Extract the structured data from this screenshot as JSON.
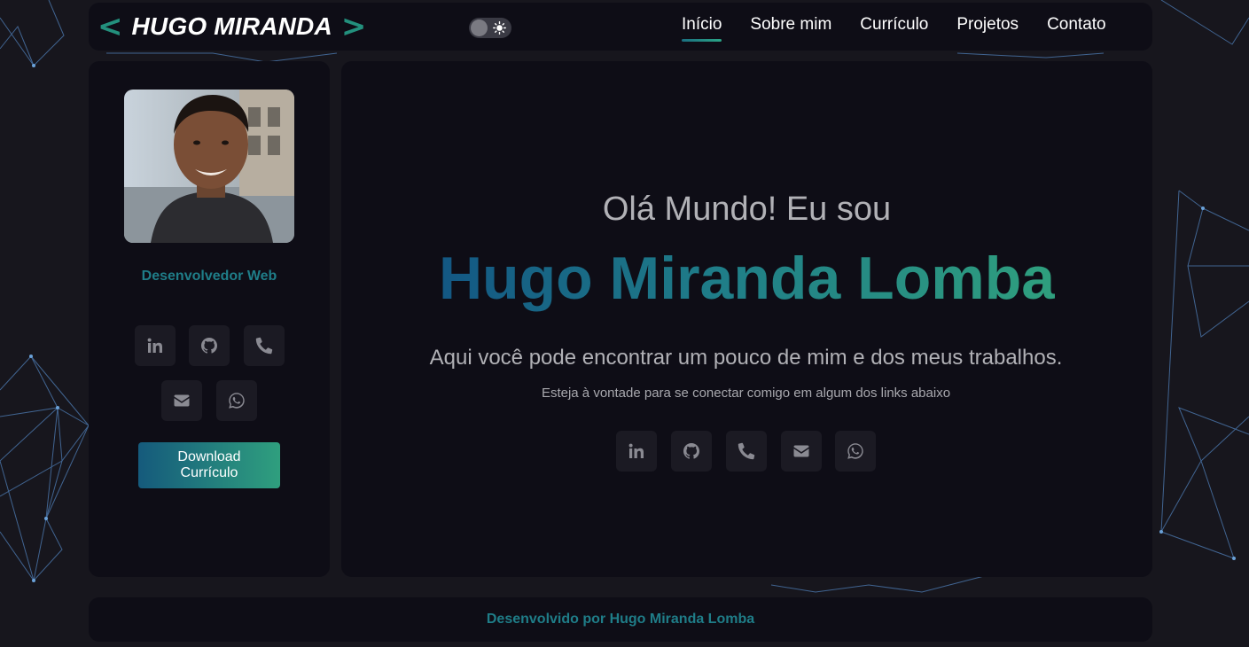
{
  "logo": {
    "left_bracket": "<",
    "text": "HUGO MIRANDA",
    "right_bracket": ">"
  },
  "theme_toggle": {
    "state": "dark",
    "icon": "sun-icon"
  },
  "nav": {
    "items": [
      {
        "label": "Início",
        "active": true
      },
      {
        "label": "Sobre mim",
        "active": false
      },
      {
        "label": "Currículo",
        "active": false
      },
      {
        "label": "Projetos",
        "active": false
      },
      {
        "label": "Contato",
        "active": false
      }
    ]
  },
  "sidebar": {
    "role": "Desenvolvedor Web",
    "social_icons": [
      "linkedin-icon",
      "github-icon",
      "phone-icon",
      "email-icon",
      "whatsapp-icon"
    ],
    "download_label": "Download\nCurrículo"
  },
  "hero": {
    "greeting": "Olá Mundo! Eu sou",
    "name": "Hugo Miranda Lomba",
    "tagline": "Aqui você pode encontrar um pouco de mim e dos meus trabalhos.",
    "subtagline": "Esteja à vontade para se conectar comigo em algum dos links abaixo",
    "social_icons": [
      "linkedin-icon",
      "github-icon",
      "phone-icon",
      "email-icon",
      "whatsapp-icon"
    ]
  },
  "footer": {
    "text": "Desenvolvido por Hugo Miranda Lomba"
  },
  "colors": {
    "accent_start": "#135783",
    "accent_end": "#2f9f7e",
    "panel_bg": "#0e0d16",
    "page_bg": "#17161d"
  }
}
